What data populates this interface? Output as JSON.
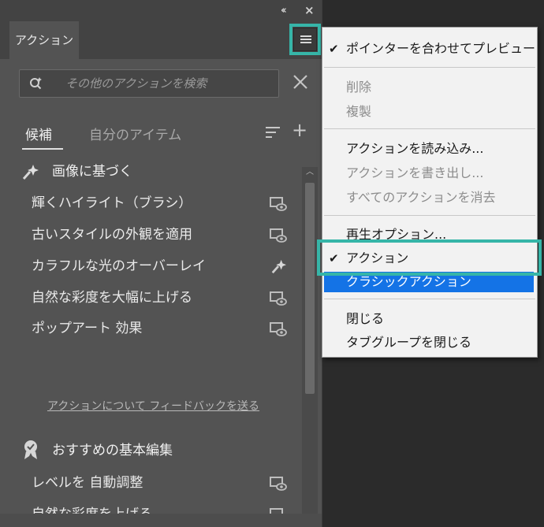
{
  "panel": {
    "tab_label": "アクション",
    "collapse_icon": "double-chevron-left-icon",
    "close_icon": "close-icon",
    "menu_icon": "hamburger-menu-icon",
    "search_placeholder": "その他のアクションを検索",
    "section_tabs": {
      "active": "候補",
      "inactive": "自分のアイテム"
    },
    "groups": [
      {
        "title": "画像に基づく",
        "icon": "sparkle-pin-icon",
        "items": [
          {
            "label": "輝くハイライト（ブラシ）",
            "icon": "preview-icon"
          },
          {
            "label": "古いスタイルの外観を適用",
            "icon": "preview-icon"
          },
          {
            "label": "カラフルな光のオーバーレイ",
            "icon": "sparkle-pin-icon"
          },
          {
            "label": "自然な彩度を大幅に上げる",
            "icon": "preview-icon"
          },
          {
            "label": "ポップアート 効果",
            "icon": "preview-icon"
          }
        ]
      },
      {
        "title": "おすすめの基本編集",
        "icon": "award-ribbon-icon",
        "items": [
          {
            "label": "レベルを 自動調整",
            "icon": "preview-icon"
          },
          {
            "label": "自然な彩度を上げる",
            "icon": "preview-icon"
          }
        ]
      }
    ],
    "feedback_link": "アクションについて フィードバックを送る"
  },
  "menu": {
    "items": [
      {
        "label": "ポインターを合わせてプレビュー",
        "checked": true,
        "disabled": false
      },
      {
        "label": "削除",
        "disabled": true
      },
      {
        "label": "複製",
        "disabled": true
      },
      {
        "label": "アクションを読み込み...",
        "disabled": false
      },
      {
        "label": "アクションを書き出し...",
        "disabled": true
      },
      {
        "label": "すべてのアクションを消去",
        "disabled": true
      },
      {
        "label": "再生オプション...",
        "disabled": false
      },
      {
        "label": "アクション",
        "checked": true,
        "disabled": false
      },
      {
        "label": "クラシックアクション",
        "highlighted": true,
        "disabled": false
      },
      {
        "label": "閉じる",
        "disabled": false
      },
      {
        "label": "タブグループを閉じる",
        "disabled": false
      }
    ]
  },
  "colors": {
    "callout_frame": "#36b5a8",
    "menu_highlight": "#1473e6",
    "panel_bg": "#535353"
  }
}
